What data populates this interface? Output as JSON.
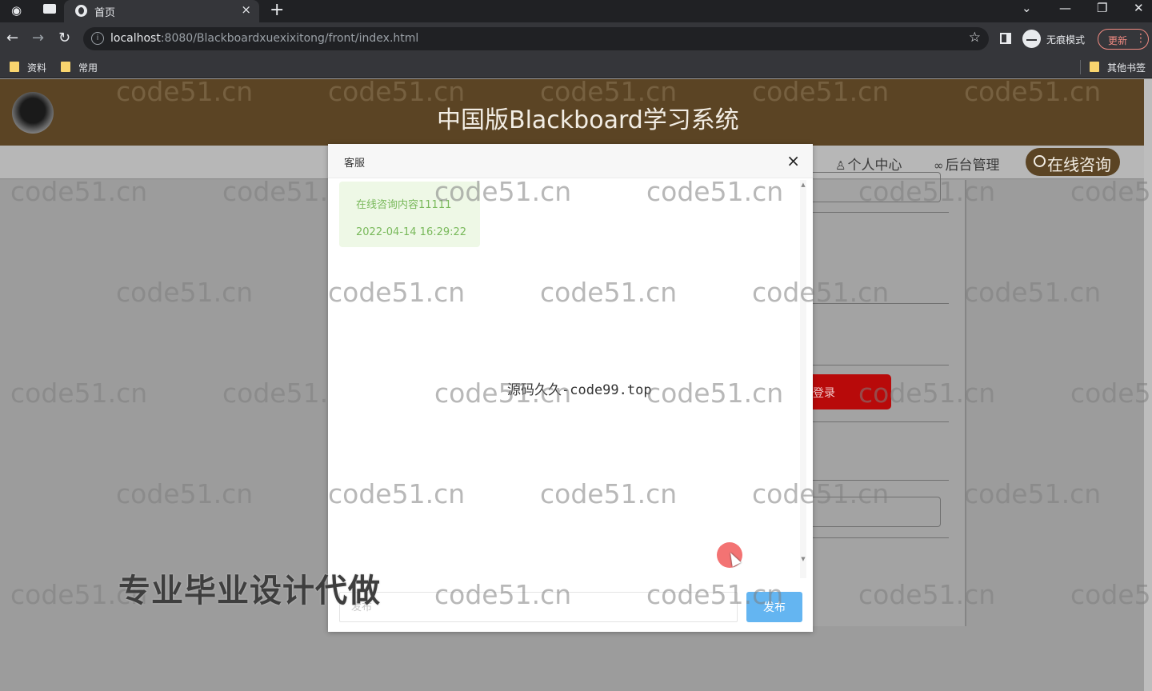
{
  "browser": {
    "tab_title": "首页",
    "tab_close": "×",
    "new_tab": "+",
    "url_host": "localhost",
    "url_rest": ":8080/Blackboardxuexixitong/front/index.html",
    "incognito_label": "无痕模式",
    "update_label": "更新",
    "bookmarks": [
      {
        "label": "资料"
      },
      {
        "label": "常用"
      },
      {
        "label": "其他书签"
      }
    ]
  },
  "site": {
    "title": "中国版Blackboard学习系统",
    "nav": {
      "profile": "个人中心",
      "admin": "后台管理",
      "online": "在线咨询"
    },
    "login_label": "登录",
    "ad_text": "专业毕业设计代做",
    "watermark": "code51.cn"
  },
  "dialog": {
    "title": "客服",
    "close": "×",
    "messages": [
      {
        "text": "在线咨询内容11111",
        "time": "2022-04-14 16:29:22"
      }
    ],
    "center_watermark": "源码久久-code99.top",
    "input_placeholder": "发布",
    "send_label": "发布"
  },
  "colors": {
    "header_brown": "#5b4424",
    "send_blue": "#64b5f1",
    "login_red": "#b80a0a",
    "message_green": "#79b95b"
  }
}
